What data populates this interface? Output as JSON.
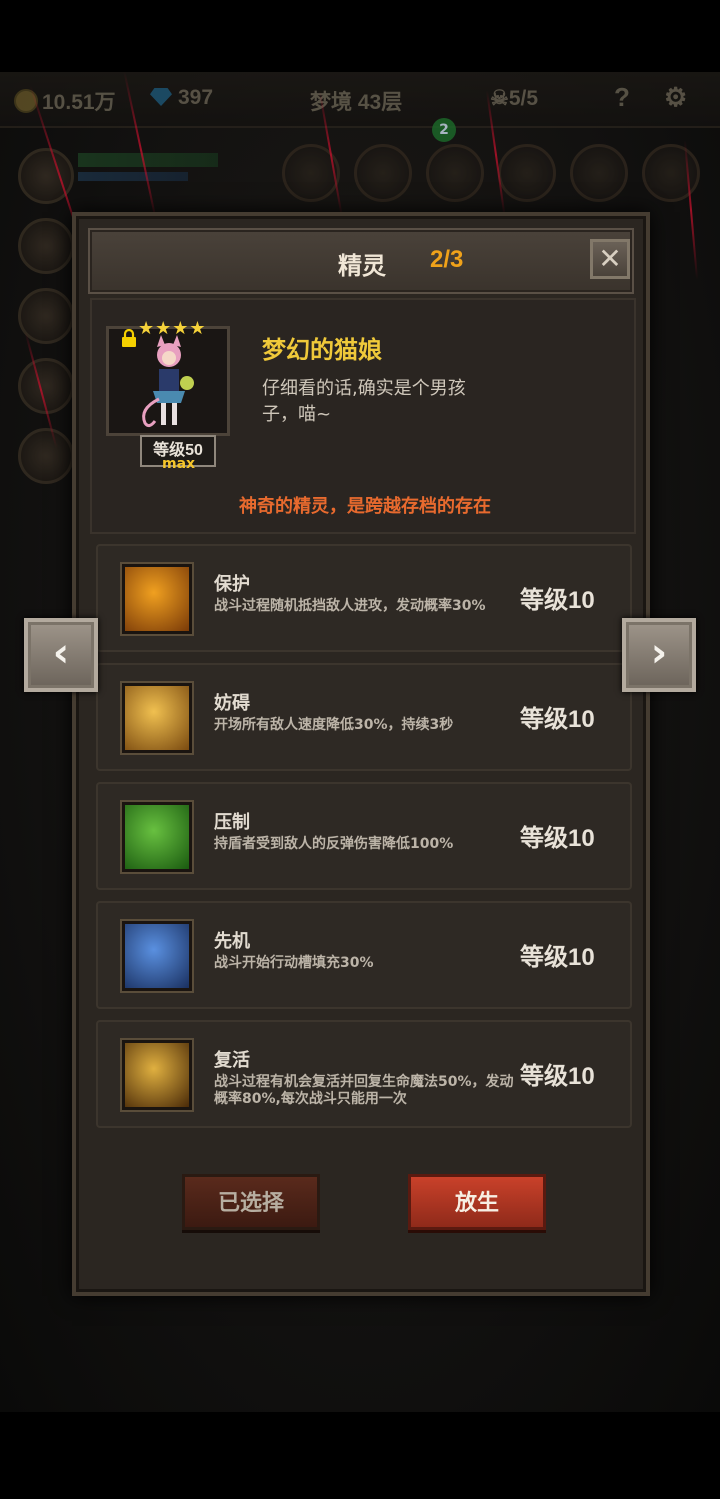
{
  "topbar": {
    "gold": "10.51万",
    "gems": "397",
    "stage": "梦境 43层",
    "skulls": "5/5",
    "help_icon": "question-icon",
    "settings_icon": "gear-icon"
  },
  "notification_count": "2",
  "modal": {
    "title": "精灵",
    "count": "2/3",
    "close_label": "✕"
  },
  "hero": {
    "name": "梦幻的猫娘",
    "description": "仔细看的话,确实是个男孩子，喵~",
    "stars": "★★★★",
    "level": "等级50",
    "max_label": "max",
    "tagline": "神奇的精灵，是跨越存档的存在"
  },
  "skills": [
    {
      "name": "保护",
      "desc": "战斗过程随机抵挡敌人进攻，发动概率30%",
      "level": "等级10",
      "icon": "phoenix-shield-icon",
      "colors": [
        "#f0a020",
        "#7a3a08"
      ]
    },
    {
      "name": "妨碍",
      "desc": "开场所有敌人速度降低30%，持续3秒",
      "level": "等级10",
      "icon": "chained-boot-icon",
      "colors": [
        "#f0c050",
        "#7a4a10"
      ]
    },
    {
      "name": "压制",
      "desc": "持盾者受到敌人的反弹伤害降低100%",
      "level": "等级10",
      "icon": "beast-claw-icon",
      "colors": [
        "#68c040",
        "#1a5a10"
      ]
    },
    {
      "name": "先机",
      "desc": "战斗开始行动槽填充30%",
      "level": "等级10",
      "icon": "leopard-icon",
      "colors": [
        "#5a90e0",
        "#1a3060"
      ]
    },
    {
      "name": "复活",
      "desc": "战斗过程有机会复活并回复生命魔法50%，发动概率80%,每次战斗只能用一次",
      "level": "等级10",
      "icon": "revive-figure-icon",
      "colors": [
        "#e0b040",
        "#4a2a08"
      ]
    }
  ],
  "buttons": {
    "selected": "已选择",
    "release": "放生"
  },
  "nav": {
    "prev": "‹",
    "next": "›"
  }
}
